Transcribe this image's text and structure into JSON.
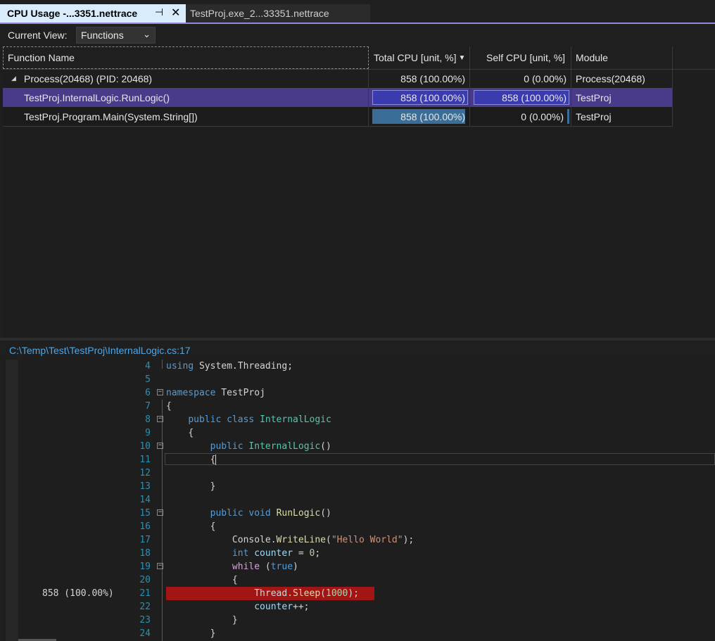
{
  "tabs": [
    {
      "title": "CPU Usage -...3351.nettrace",
      "active": true
    },
    {
      "title": "TestProj.exe_2...33351.nettrace",
      "active": false
    }
  ],
  "current_view": {
    "label": "Current View:",
    "value": "Functions"
  },
  "grid": {
    "columns": [
      "Function Name",
      "Total CPU [unit, %]",
      "Self CPU [unit, %]",
      "Module"
    ],
    "rows": [
      {
        "name": "Process(20468) (PID: 20468)",
        "total": "858 (100.00%)",
        "self": "0 (0.00%)",
        "module": "Process(20468)",
        "expanded": true
      },
      {
        "name": "TestProj.InternalLogic.RunLogic()",
        "total": "858 (100.00%)",
        "self": "858 (100.00%)",
        "module": "TestProj",
        "selected": true
      },
      {
        "name": "TestProj.Program.Main(System.String[])",
        "total": "858 (100.00%)",
        "self": "0 (0.00%)",
        "module": "TestProj"
      }
    ]
  },
  "source_path": "C:\\Temp\\Test\\TestProj\\InternalLogic.cs:17",
  "editor": {
    "line_numbers": [
      "4",
      "5",
      "6",
      "7",
      "8",
      "9",
      "10",
      "11",
      "12",
      "13",
      "14",
      "15",
      "16",
      "17",
      "18",
      "19",
      "20",
      "21",
      "22",
      "23",
      "24"
    ],
    "hot_line_cpu": "858 (100.00%)",
    "lines": {
      "l4_using": "using",
      "l4_rest": " System.Threading;",
      "l6_ns": "namespace",
      "l6_name": " TestProj",
      "l7": "{",
      "l8_public": "public",
      "l8_class": "class",
      "l8_name": "InternalLogic",
      "l9": "{",
      "l10_public": "public",
      "l10_name": "InternalLogic",
      "l10_paren": "()",
      "l11": "{",
      "l13": "}",
      "l15_public": "public",
      "l15_void": "void",
      "l15_name": "RunLogic",
      "l15_paren": "()",
      "l16": "{",
      "l17_cls": "Console",
      "l17_method": "WriteLine",
      "l17_str": "\"Hello World\"",
      "l18_int": "int",
      "l18_var": "counter",
      "l18_num": "0",
      "l19_while": "while",
      "l19_true": "true",
      "l20": "{",
      "l21_cls": "Thread",
      "l21_method": "Sleep",
      "l21_num": "1000",
      "l22_var": "counter",
      "l22_op": "++;",
      "l23": "}",
      "l24": "}"
    }
  }
}
